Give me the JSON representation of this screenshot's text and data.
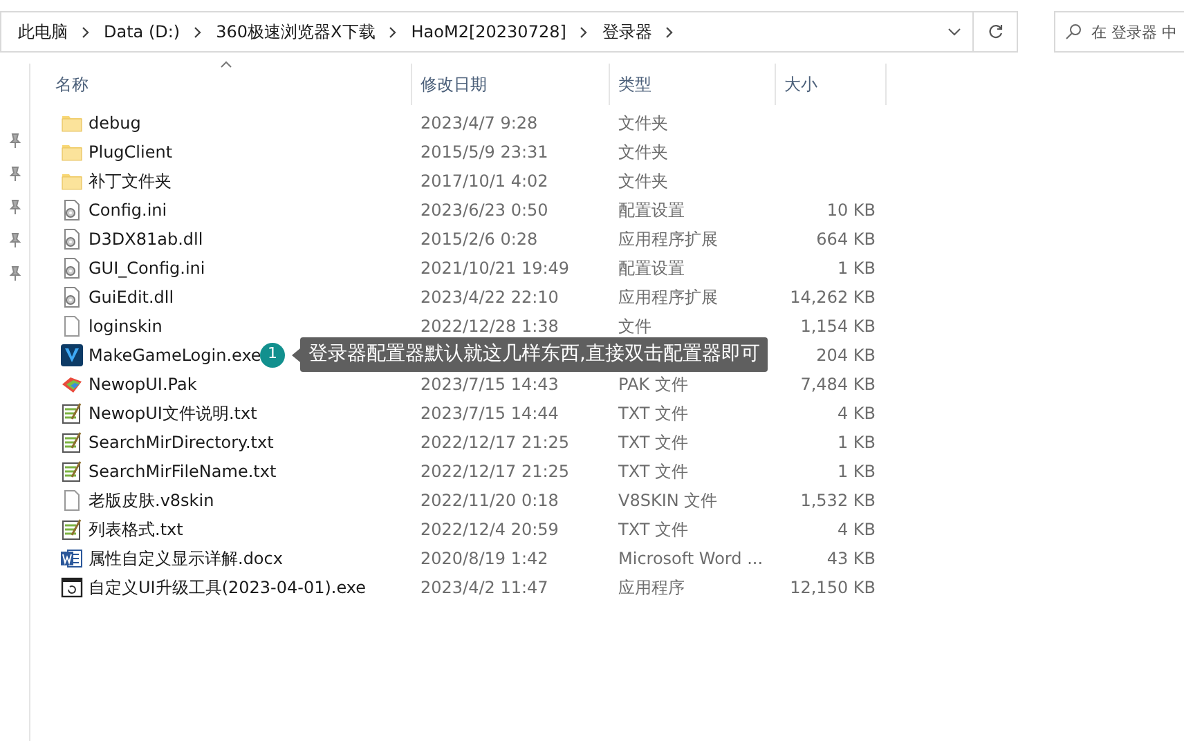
{
  "breadcrumb": [
    "此电脑",
    "Data (D:)",
    "360极速浏览器X下载",
    "HaoM2[20230728]",
    "登录器"
  ],
  "search": {
    "placeholder": "在 登录器 中"
  },
  "columns": [
    "名称",
    "修改日期",
    "类型",
    "大小"
  ],
  "files": [
    {
      "kind": "folder",
      "name": "debug",
      "date": "2023/4/7 9:28",
      "type": "文件夹"
    },
    {
      "kind": "folder",
      "name": "PlugClient",
      "date": "2015/5/9 23:31",
      "type": "文件夹"
    },
    {
      "kind": "folder",
      "name": "补丁文件夹",
      "date": "2017/10/1 4:02",
      "type": "文件夹"
    },
    {
      "kind": "ini",
      "name": "Config.ini",
      "date": "2023/6/23 0:50",
      "type": "配置设置",
      "size": "10 KB"
    },
    {
      "kind": "dll",
      "name": "D3DX81ab.dll",
      "date": "2015/2/6 0:28",
      "type": "应用程序扩展",
      "size": "664 KB"
    },
    {
      "kind": "ini",
      "name": "GUI_Config.ini",
      "date": "2021/10/21 19:49",
      "type": "配置设置",
      "size": "1 KB"
    },
    {
      "kind": "dll",
      "name": "GuiEdit.dll",
      "date": "2023/4/22 22:10",
      "type": "应用程序扩展",
      "size": "14,262 KB"
    },
    {
      "kind": "file",
      "name": "loginskin",
      "date": "2022/12/28 1:38",
      "type": "文件",
      "size": "1,154 KB"
    },
    {
      "kind": "app",
      "name": "MakeGameLogin.exe",
      "size": "204 KB",
      "callout": {
        "number": "1",
        "text": "登录器配置器默认就这几样东西,直接双击配置器即可"
      }
    },
    {
      "kind": "pak",
      "name": "NewopUI.Pak",
      "date": "2023/7/15 14:43",
      "type": "PAK 文件",
      "size": "7,484 KB"
    },
    {
      "kind": "txt",
      "name": "NewopUI文件说明.txt",
      "date": "2023/7/15 14:44",
      "type": "TXT 文件",
      "size": "4 KB"
    },
    {
      "kind": "txt",
      "name": "SearchMirDirectory.txt",
      "date": "2022/12/17 21:25",
      "type": "TXT 文件",
      "size": "1 KB"
    },
    {
      "kind": "txt",
      "name": "SearchMirFileName.txt",
      "date": "2022/12/17 21:25",
      "type": "TXT 文件",
      "size": "1 KB"
    },
    {
      "kind": "file",
      "name": "老版皮肤.v8skin",
      "date": "2022/11/20 0:18",
      "type": "V8SKIN 文件",
      "size": "1,532 KB"
    },
    {
      "kind": "txt",
      "name": "列表格式.txt",
      "date": "2022/12/4 20:59",
      "type": "TXT 文件",
      "size": "4 KB"
    },
    {
      "kind": "word",
      "name": "属性自定义显示详解.docx",
      "date": "2020/8/19 1:42",
      "type": "Microsoft Word ...",
      "size": "43 KB"
    },
    {
      "kind": "exe",
      "name": "自定义UI升级工具(2023-04-01).exe",
      "date": "2023/4/2 11:47",
      "type": "应用程序",
      "size": "12,150 KB"
    }
  ]
}
